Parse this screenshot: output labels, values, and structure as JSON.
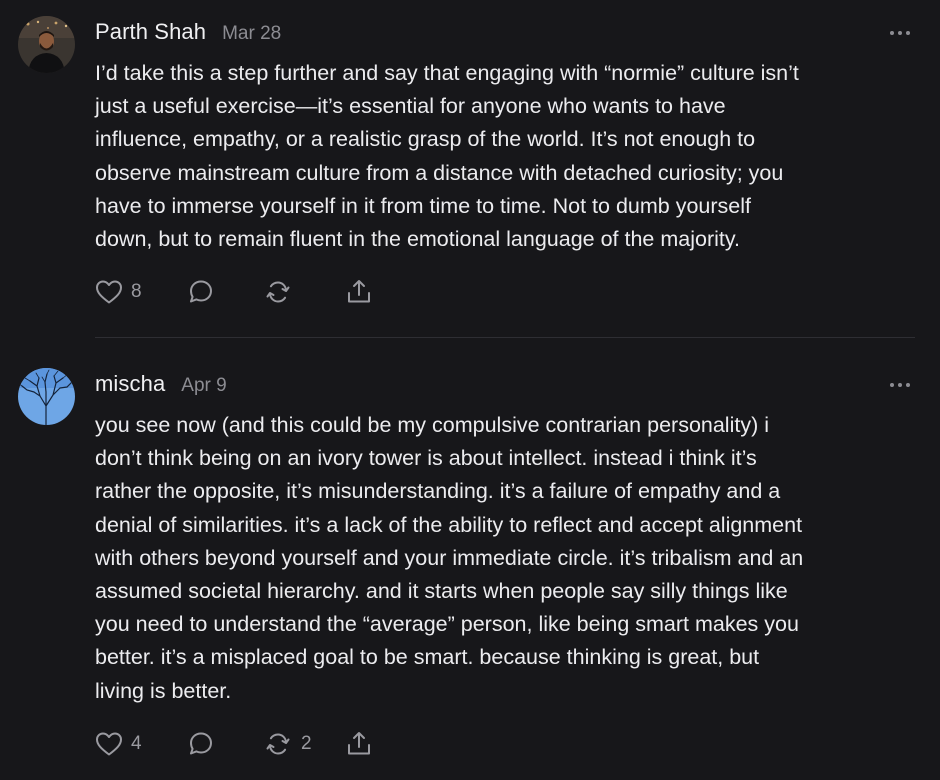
{
  "comments": [
    {
      "author": "Parth Shah",
      "date": "Mar 28",
      "text": "I’d take this a step further and say that engaging with “normie” culture isn’t\njust a useful exercise—it’s essential for anyone who wants to have\ninfluence, empathy, or a realistic grasp of the world. It’s not enough to\nobserve mainstream culture from a distance with detached curiosity; you\nhave to immerse yourself in it from time to time. Not to dumb yourself\ndown, but to remain fluent in the emotional language of the majority.",
      "likes": "8",
      "restacks": ""
    },
    {
      "author": "mischa",
      "date": "Apr 9",
      "text": "you see now (and this could be my compulsive contrarian personality) i\ndon’t think being on an ivory tower is about intellect. instead i think it’s\nrather the opposite, it’s misunderstanding. it’s a failure of empathy and a\ndenial of similarities. it’s a lack of the ability to reflect and accept alignment\nwith others beyond yourself and your immediate circle. it’s tribalism and an\nassumed societal hierarchy. and it starts when people say silly things like\nyou need to understand the “average” person, like being smart makes you\nbetter. it’s a misplaced goal to be smart. because thinking is great, but\nliving is better.",
      "likes": "4",
      "restacks": "2"
    }
  ],
  "icons": {
    "like": "heart-icon",
    "reply": "speech-bubble-icon",
    "restack": "restack-icon",
    "share": "share-icon",
    "more": "more-options-icon"
  },
  "colors": {
    "background": "#17171a",
    "text": "#ececef",
    "muted": "#8c8c92",
    "divider": "#2e2e33"
  }
}
